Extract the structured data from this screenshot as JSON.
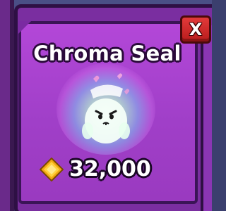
{
  "item": {
    "name": "Chroma Seal",
    "price": "32,000",
    "currency_icon": "gem-icon",
    "pet_icon": "seal-pet-icon"
  },
  "close_button": {
    "label": "X"
  },
  "colors": {
    "card": "#a840d0",
    "card_border": "#3a1456",
    "close": "#d22a2a",
    "gem": "#f4b21a"
  }
}
